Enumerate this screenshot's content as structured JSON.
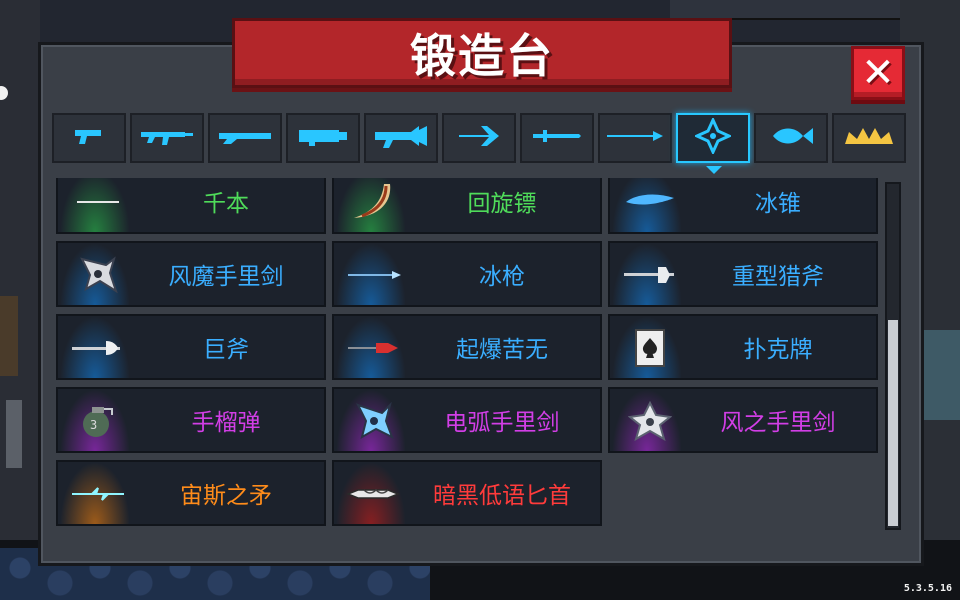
{
  "title": "锻造台",
  "close_icon": "close-icon",
  "version": "5.3.5.16",
  "colors": {
    "green": "#4fdc5a",
    "blue": "#3aaeff",
    "purple": "#d23ee6",
    "orange": "#ff8c1a",
    "red": "#ff3b3b",
    "accent": "#28c8ff"
  },
  "tabs": [
    {
      "icon": "pistol-icon",
      "active": false
    },
    {
      "icon": "rifle-icon",
      "active": false
    },
    {
      "icon": "shotgun-icon",
      "active": false
    },
    {
      "icon": "launcher-icon",
      "active": false
    },
    {
      "icon": "laser-gun-icon",
      "active": false
    },
    {
      "icon": "bow-icon",
      "active": false
    },
    {
      "icon": "sword-icon",
      "active": false
    },
    {
      "icon": "spear-icon",
      "active": false
    },
    {
      "icon": "throwing-icon",
      "active": true
    },
    {
      "icon": "fish-icon",
      "active": false
    },
    {
      "icon": "crown-icon",
      "active": false
    }
  ],
  "items": [
    {
      "label": "千本",
      "rarity": "green",
      "icon": "needle-icon"
    },
    {
      "label": "回旋镖",
      "rarity": "green",
      "icon": "boomerang-icon"
    },
    {
      "label": "冰锥",
      "rarity": "blue",
      "icon": "icicle-icon"
    },
    {
      "label": "风魔手里剑",
      "rarity": "blue",
      "icon": "shuriken-icon"
    },
    {
      "label": "冰枪",
      "rarity": "blue",
      "icon": "ice-spear-icon"
    },
    {
      "label": "重型猎斧",
      "rarity": "blue",
      "icon": "hunting-axe-icon"
    },
    {
      "label": "巨斧",
      "rarity": "blue",
      "icon": "giant-axe-icon"
    },
    {
      "label": "起爆苦无",
      "rarity": "blue",
      "icon": "kunai-icon"
    },
    {
      "label": "扑克牌",
      "rarity": "blue",
      "icon": "poker-card-icon"
    },
    {
      "label": "手榴弹",
      "rarity": "purple",
      "icon": "grenade-icon"
    },
    {
      "label": "电弧手里剑",
      "rarity": "purple",
      "icon": "arc-shuriken-icon"
    },
    {
      "label": "风之手里剑",
      "rarity": "purple",
      "icon": "wind-shuriken-icon"
    },
    {
      "label": "宙斯之矛",
      "rarity": "orange",
      "icon": "zeus-spear-icon"
    },
    {
      "label": "暗黑低语匕首",
      "rarity": "red",
      "icon": "dark-dagger-icon"
    }
  ]
}
